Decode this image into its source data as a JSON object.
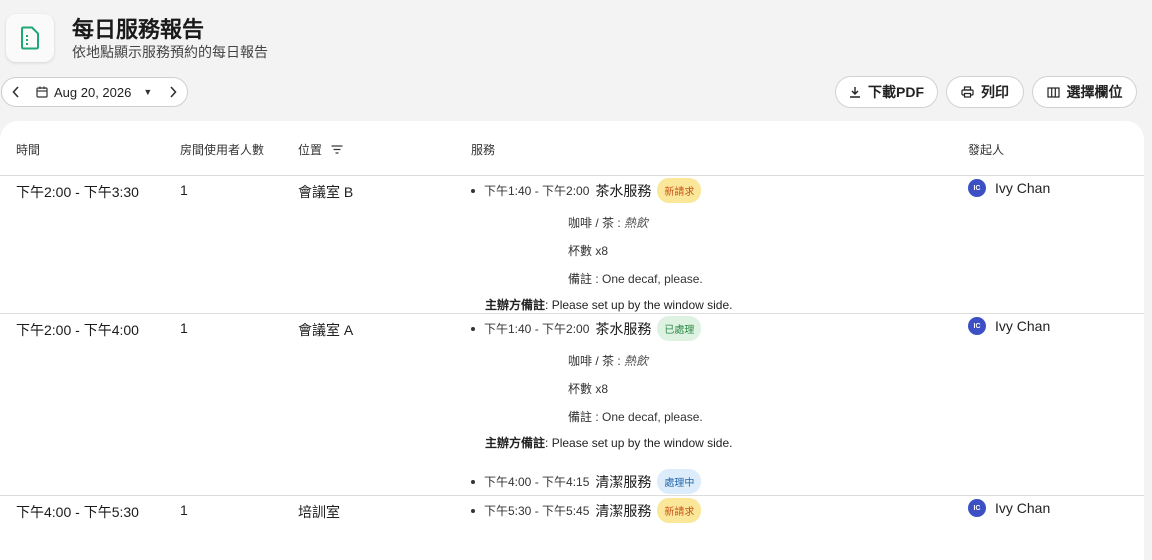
{
  "header": {
    "title": "每日服務報告",
    "subtitle": "依地點顯示服務預約的每日報告"
  },
  "date_picker": {
    "value": "Aug 20, 2026"
  },
  "toolbar": {
    "download_label": "下載PDF",
    "print_label": "列印",
    "columns_label": "選擇欄位"
  },
  "table": {
    "headers": {
      "time": "時間",
      "occupants": "房間使用者人數",
      "location": "位置",
      "service": "服務",
      "requester": "發起人"
    },
    "rows": [
      {
        "time": "下午2:00 - 下午3:30",
        "occupants": "1",
        "location": "會議室 B",
        "requester": {
          "initials": "IC",
          "name": "Ivy Chan"
        },
        "services": [
          {
            "time": "下午1:40 - 下午2:00",
            "name": "茶水服務",
            "status": "新請求",
            "item_label": "咖啡 / 茶",
            "item_value": "熱飲",
            "qty_label": "杯數",
            "qty_value": "x8",
            "note_label": "備註",
            "note_value": "One decaf, please.",
            "host_label": "主辦方備註",
            "host_value": "Please set up by the window side."
          }
        ]
      },
      {
        "time": "下午2:00 - 下午4:00",
        "occupants": "1",
        "location": "會議室 A",
        "requester": {
          "initials": "IC",
          "name": "Ivy Chan"
        },
        "services": [
          {
            "time": "下午1:40 - 下午2:00",
            "name": "茶水服務",
            "status": "已處理",
            "item_label": "咖啡 / 茶",
            "item_value": "熱飲",
            "qty_label": "杯數",
            "qty_value": "x8",
            "note_label": "備註",
            "note_value": "One decaf, please.",
            "host_label": "主辦方備註",
            "host_value": "Please set up by the window side."
          },
          {
            "time": "下午4:00 - 下午4:15",
            "name": "清潔服務",
            "status": "處理中"
          }
        ]
      },
      {
        "time": "下午4:00 - 下午5:30",
        "occupants": "1",
        "location": "培訓室",
        "requester": {
          "initials": "IC",
          "name": "Ivy Chan"
        },
        "services": [
          {
            "time": "下午5:30 - 下午5:45",
            "name": "清潔服務",
            "status": "新請求"
          }
        ]
      }
    ]
  }
}
